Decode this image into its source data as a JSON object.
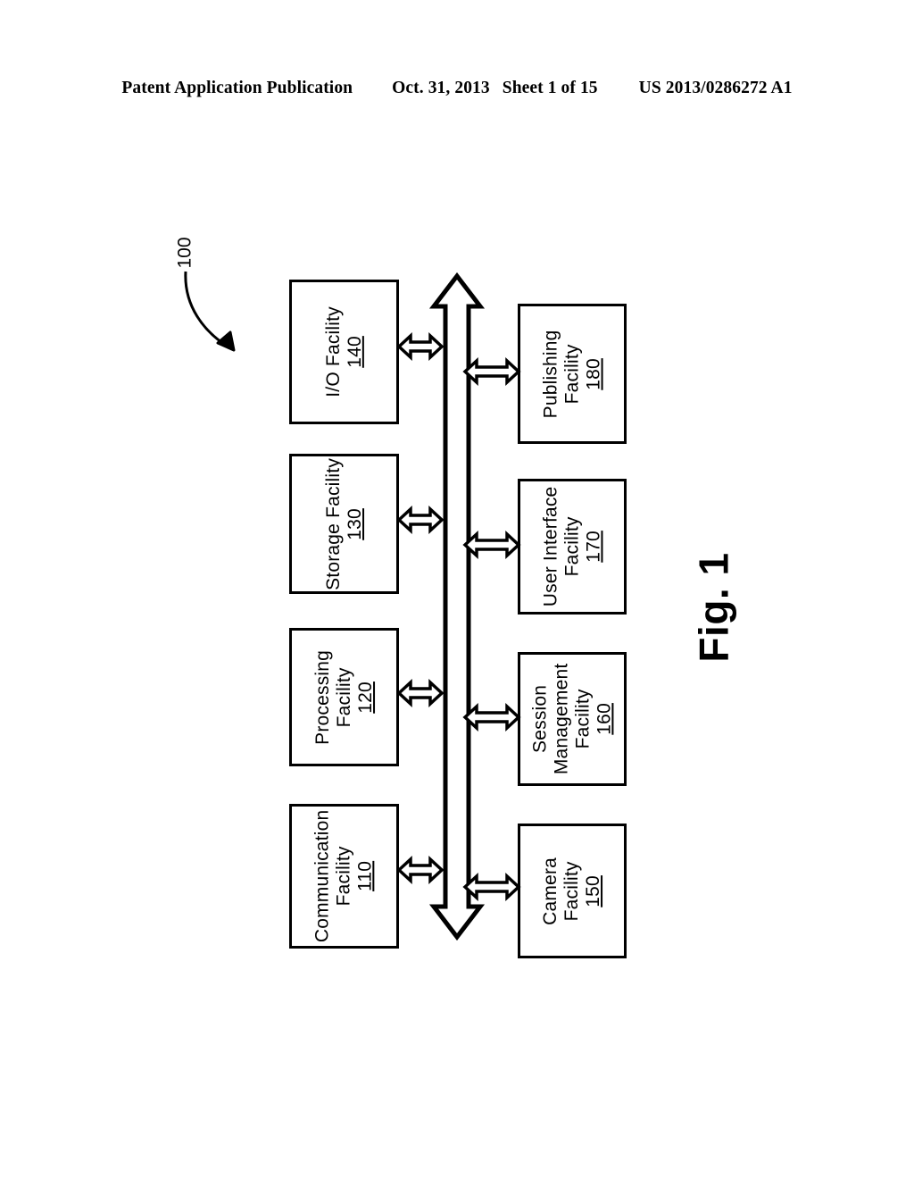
{
  "header": {
    "publication": "Patent Application Publication",
    "date": "Oct. 31, 2013",
    "sheet": "Sheet 1 of 15",
    "patent_number": "US 2013/0286272 A1"
  },
  "figure": {
    "caption": "Fig. 1",
    "system_reference": "100",
    "colors": {
      "stroke": "#000000",
      "background": "#ffffff"
    },
    "bus": {
      "name": "system-bus",
      "direction": "bidirectional-vertical"
    },
    "left_column": [
      {
        "title": "I/O Facility",
        "ref": "140",
        "lines": [
          "I/O Facility"
        ]
      },
      {
        "title": "Storage Facility",
        "ref": "130",
        "lines": [
          "Storage Facility"
        ]
      },
      {
        "title": "Processing Facility",
        "ref": "120",
        "lines": [
          "Processing",
          "Facility"
        ]
      },
      {
        "title": "Communication Facility",
        "ref": "110",
        "lines": [
          "Communication",
          "Facility"
        ]
      }
    ],
    "right_column": [
      {
        "title": "Publishing Facility",
        "ref": "180",
        "lines": [
          "Publishing",
          "Facility"
        ]
      },
      {
        "title": "User Interface Facility",
        "ref": "170",
        "lines": [
          "User Interface",
          "Facility"
        ]
      },
      {
        "title": "Session Management Facility",
        "ref": "160",
        "lines": [
          "Session",
          "Management",
          "Facility"
        ]
      },
      {
        "title": "Camera Facility",
        "ref": "150",
        "lines": [
          "Camera",
          "Facility"
        ]
      }
    ],
    "boxes": {
      "b140": {
        "l1": "I/O Facility",
        "ref": "140"
      },
      "b130": {
        "l1": "Storage Facility",
        "ref": "130"
      },
      "b120": {
        "l1": "Processing",
        "l2": "Facility",
        "ref": "120"
      },
      "b110": {
        "l1": "Communication",
        "l2": "Facility",
        "ref": "110"
      },
      "b180": {
        "l1": "Publishing",
        "l2": "Facility",
        "ref": "180"
      },
      "b170": {
        "l1": "User Interface",
        "l2": "Facility",
        "ref": "170"
      },
      "b160": {
        "l1": "Session",
        "l2": "Management",
        "l3": "Facility",
        "ref": "160"
      },
      "b150": {
        "l1": "Camera",
        "l2": "Facility",
        "ref": "150"
      }
    }
  }
}
